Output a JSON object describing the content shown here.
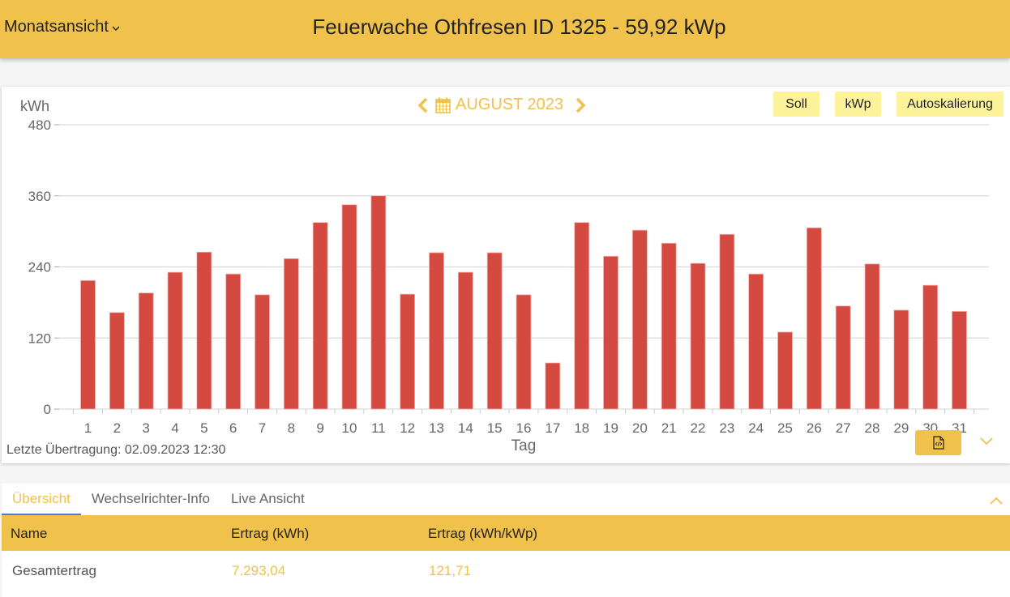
{
  "header": {
    "view_selector": "Monatsansicht",
    "title": "Feuerwache Othfresen ID 1325 - 59,92 kWp"
  },
  "chart_nav": {
    "month_label": "AUGUST 2023"
  },
  "chart_buttons": {
    "soll": "Soll",
    "kwp": "kWp",
    "autoscale": "Autoskalierung"
  },
  "status": {
    "last_transfer": "Letzte Übertragung: 02.09.2023 12:30"
  },
  "colors": {
    "accent": "#f0c14b",
    "bar": "#d44a40",
    "chip": "#fdf39a",
    "tab_underline": "#4a7fd0"
  },
  "chart_data": {
    "type": "bar",
    "title": "AUGUST 2023",
    "xlabel": "Tag",
    "ylabel": "kWh",
    "ylim": [
      0,
      480
    ],
    "yticks": [
      0,
      120,
      240,
      360,
      480
    ],
    "grid": true,
    "categories": [
      "1",
      "2",
      "3",
      "4",
      "5",
      "6",
      "7",
      "8",
      "9",
      "10",
      "11",
      "12",
      "13",
      "14",
      "15",
      "16",
      "17",
      "18",
      "19",
      "20",
      "21",
      "22",
      "23",
      "24",
      "25",
      "26",
      "27",
      "28",
      "29",
      "30",
      "31"
    ],
    "values": [
      217,
      163,
      196,
      231,
      265,
      228,
      193,
      254,
      315,
      345,
      360,
      194,
      264,
      231,
      264,
      193,
      78,
      315,
      258,
      302,
      280,
      246,
      295,
      228,
      130,
      306,
      174,
      245,
      167,
      209,
      165
    ]
  },
  "tabs": [
    {
      "label": "Übersicht",
      "active": true
    },
    {
      "label": "Wechselrichter-Info",
      "active": false
    },
    {
      "label": "Live Ansicht",
      "active": false
    }
  ],
  "table": {
    "headers": [
      "Name",
      "Ertrag (kWh)",
      "Ertrag (kWh/kWp)"
    ],
    "rows": [
      [
        "Gesamtertrag",
        "7.293,04",
        "121,71"
      ]
    ]
  }
}
